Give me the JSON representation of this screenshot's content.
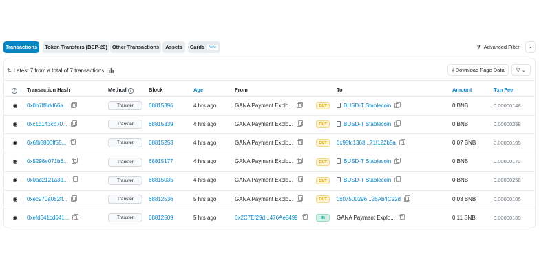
{
  "tabs": [
    {
      "label": "Transactions",
      "active": true
    },
    {
      "label": "Token Transfers (BEP-20)",
      "active": false
    },
    {
      "label": "Other Transactions",
      "active": false
    },
    {
      "label": "Assets",
      "active": false
    },
    {
      "label": "Cards",
      "active": false,
      "badge": "New"
    }
  ],
  "advanced_filter": {
    "label": "Advanced Filter"
  },
  "summary": {
    "text": "Latest 7 from a total of 7 transactions"
  },
  "download": {
    "label": "Download Page Data"
  },
  "columns": {
    "hash": "Transaction Hash",
    "method": "Method",
    "block": "Block",
    "age": "Age",
    "from": "From",
    "to": "To",
    "amount": "Amount",
    "fee": "Txn Fee"
  },
  "rows": [
    {
      "hash": "0x0b7ff8dd66a...",
      "method": "Transfer",
      "block": "68815396",
      "age": "4 hrs ago",
      "from": "GANA Payment Explo...",
      "from_link": false,
      "dir": "OUT",
      "to": "BUSD-T Stablecoin",
      "to_contract": true,
      "to_link": true,
      "amount": "0 BNB",
      "fee": "0.00000148"
    },
    {
      "hash": "0xc1d143cb70...",
      "method": "Transfer",
      "block": "68815339",
      "age": "4 hrs ago",
      "from": "GANA Payment Explo...",
      "from_link": false,
      "dir": "OUT",
      "to": "BUSD-T Stablecoin",
      "to_contract": true,
      "to_link": true,
      "amount": "0 BNB",
      "fee": "0.00000258"
    },
    {
      "hash": "0x6fb8800ff55...",
      "method": "Transfer",
      "block": "68815253",
      "age": "4 hrs ago",
      "from": "GANA Payment Explo...",
      "from_link": false,
      "dir": "OUT",
      "to": "0x98fc1363...71f122b5a",
      "to_contract": false,
      "to_link": true,
      "amount": "0.07 BNB",
      "fee": "0.00000105"
    },
    {
      "hash": "0x5298e071b6...",
      "method": "Transfer",
      "block": "68815177",
      "age": "4 hrs ago",
      "from": "GANA Payment Explo...",
      "from_link": false,
      "dir": "OUT",
      "to": "BUSD-T Stablecoin",
      "to_contract": true,
      "to_link": true,
      "amount": "0 BNB",
      "fee": "0.00000172"
    },
    {
      "hash": "0x0ad2121a3d...",
      "method": "Transfer",
      "block": "68815035",
      "age": "4 hrs ago",
      "from": "GANA Payment Explo...",
      "from_link": false,
      "dir": "OUT",
      "to": "BUSD-T Stablecoin",
      "to_contract": true,
      "to_link": true,
      "amount": "0 BNB",
      "fee": "0.00000258"
    },
    {
      "hash": "0xec970a052ff...",
      "method": "Transfer",
      "block": "68812536",
      "age": "5 hrs ago",
      "from": "GANA Payment Explo...",
      "from_link": false,
      "dir": "OUT",
      "to": "0x07500296...25Ab4C92d",
      "to_contract": false,
      "to_link": true,
      "amount": "0.03 BNB",
      "fee": "0.00000105"
    },
    {
      "hash": "0xefd641cd641...",
      "method": "Transfer",
      "block": "68812509",
      "age": "5 hrs ago",
      "from": "0x2C7Ef29d...476Ae8499",
      "from_link": true,
      "dir": "IN",
      "to": "GANA Payment Explo...",
      "to_contract": false,
      "to_link": false,
      "amount": "0.11 BNB",
      "fee": "0.00000105"
    }
  ],
  "colors": {
    "accent": "#0784c3",
    "out": "#cc9a06",
    "in": "#00a186"
  }
}
